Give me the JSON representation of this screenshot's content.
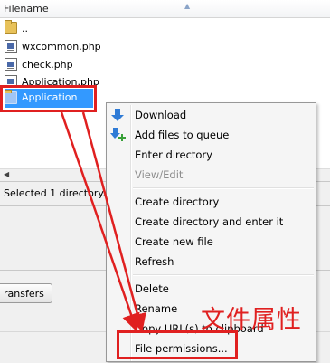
{
  "file_list": {
    "column_header": "Filename",
    "rows": [
      {
        "name": "..",
        "icon": "folder-icon"
      },
      {
        "name": "wxcommon.php",
        "icon": "php-file-icon"
      },
      {
        "name": "check.php",
        "icon": "php-file-icon"
      },
      {
        "name": "Application.php",
        "icon": "php-file-icon"
      }
    ],
    "selected": {
      "name": "Application",
      "icon": "folder-icon"
    }
  },
  "status": {
    "text": "Selected 1 directory."
  },
  "tabs": {
    "transfers_partial": "ransfers"
  },
  "context_menu": {
    "items": [
      {
        "label": "Download",
        "icon": "download-icon"
      },
      {
        "label": "Add files to queue",
        "icon": "add-to-queue-icon"
      },
      {
        "label": "Enter directory"
      },
      {
        "label": "View/Edit",
        "disabled": true
      },
      {
        "label": "Create directory"
      },
      {
        "label": "Create directory and enter it"
      },
      {
        "label": "Create new file"
      },
      {
        "label": "Refresh"
      },
      {
        "label": "Delete"
      },
      {
        "label": "Rename"
      },
      {
        "label": "Copy URL(s) to clipboard"
      },
      {
        "label": "File permissions..."
      }
    ]
  },
  "annotation": {
    "text": "文件属性",
    "color": "#e02020"
  },
  "colors": {
    "selection": "#3399ff",
    "highlight": "#e02020"
  }
}
